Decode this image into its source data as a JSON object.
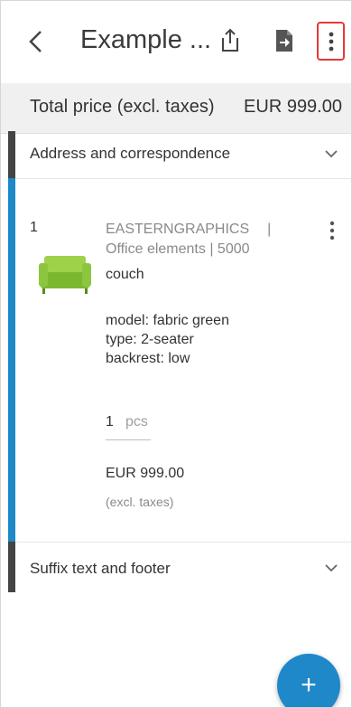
{
  "header": {
    "title": "Example ...",
    "back_icon": "chevron-left-icon",
    "share_icon": "share-icon",
    "export_icon": "file-export-icon",
    "more_icon": "more-vertical-icon"
  },
  "summary": {
    "label": "Total price (excl. taxes)",
    "value": "EUR 999.00"
  },
  "sections": {
    "address": {
      "title": "Address and correspondence"
    },
    "suffix": {
      "title": "Suffix text and footer"
    }
  },
  "item": {
    "position": "1",
    "manufacturer": "EASTERNGRAPHICS",
    "separator": "|",
    "catalog": "Office elements | 5000",
    "name": "couch",
    "properties": [
      "model: fabric green",
      "type: 2-seater",
      "backrest: low"
    ],
    "quantity": "1",
    "unit": "pcs",
    "price": "EUR 999.00",
    "tax_note": "(excl. taxes)"
  },
  "fab": {
    "label": "+"
  },
  "colors": {
    "accent_blue": "#1e88c9",
    "accent_dark": "#444444",
    "highlight_red": "#e53935",
    "couch_green": "#8cc63f"
  }
}
